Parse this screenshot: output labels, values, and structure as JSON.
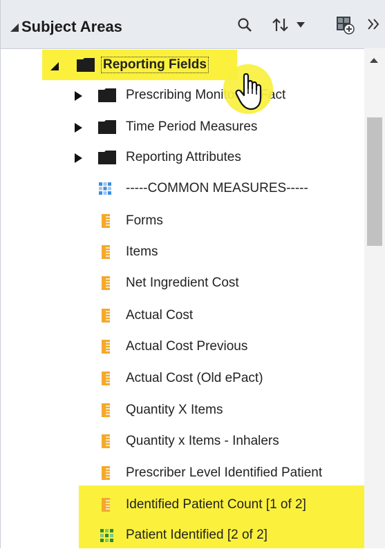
{
  "header": {
    "title": "Subject Areas",
    "icons": [
      "collapse-triangle-icon",
      "search-icon",
      "sort-icon",
      "dropdown-caret-icon",
      "add-to-view-icon",
      "expand-panel-icon"
    ]
  },
  "tree": {
    "root": {
      "label": "Reporting Fields",
      "icon": "folder-icon",
      "expanded": true,
      "highlighted": true
    },
    "folders": [
      {
        "label": "Prescribing Monitoring Fact",
        "icon": "folder-icon"
      },
      {
        "label": "Time Period Measures",
        "icon": "folder-icon"
      },
      {
        "label": "Reporting Attributes",
        "icon": "folder-icon"
      }
    ],
    "separator": {
      "label": "-----COMMON MEASURES-----",
      "icon": "blue-grid-icon"
    },
    "measures": [
      {
        "label": "Forms",
        "icon": "measure-ruler-icon"
      },
      {
        "label": "Items",
        "icon": "measure-ruler-icon"
      },
      {
        "label": "Net Ingredient Cost",
        "icon": "measure-ruler-icon"
      },
      {
        "label": "Actual Cost",
        "icon": "measure-ruler-icon"
      },
      {
        "label": "Actual Cost Previous",
        "icon": "measure-ruler-icon"
      },
      {
        "label": "Actual Cost (Old ePact)",
        "icon": "measure-ruler-icon"
      },
      {
        "label": "Quantity X Items",
        "icon": "measure-ruler-icon"
      },
      {
        "label": "Quantity x Items - Inhalers",
        "icon": "measure-ruler-icon"
      },
      {
        "label": "Prescriber Level Identified Patient",
        "icon": "measure-ruler-icon"
      },
      {
        "label": "Identified Patient Count [1 of 2]",
        "icon": "measure-ruler-icon",
        "highlighted": true
      },
      {
        "label": "Patient Identified [2 of 2]",
        "icon": "green-grid-icon",
        "highlighted": true
      }
    ]
  },
  "colors": {
    "highlight": "#fbf13c",
    "header_bg": "#e8ecf1",
    "measure_icon": "#f4a92a",
    "grid_blue": "#3d8ee0",
    "grid_green": "#2e8b2e"
  }
}
